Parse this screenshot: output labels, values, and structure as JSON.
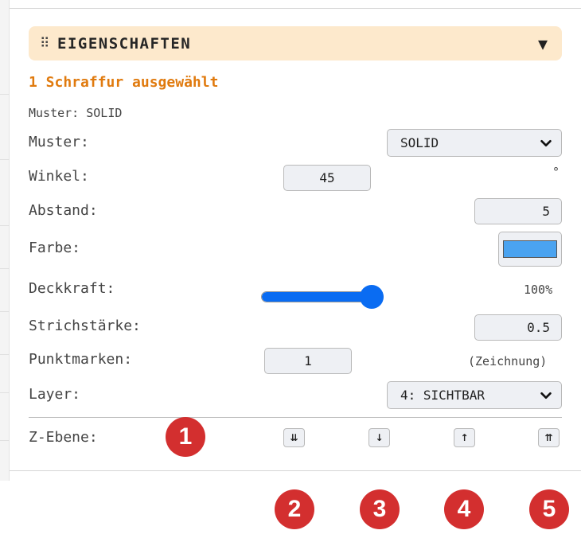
{
  "panel": {
    "title": "EIGENSCHAFTEN",
    "grip_icon": "drag-grip-icon",
    "toggle_icon": "collapse-triangle-icon",
    "toggle_glyph": "▼"
  },
  "selection": {
    "title": "1 Schraffur ausgewählt",
    "subtitle": "Muster: SOLID"
  },
  "fields": {
    "muster": {
      "label": "Muster:",
      "value": "SOLID"
    },
    "winkel": {
      "label": "Winkel:",
      "value": "45",
      "unit": "°"
    },
    "abstand": {
      "label": "Abstand:",
      "value": "5"
    },
    "farbe": {
      "label": "Farbe:",
      "color": "#4aa3f0"
    },
    "deckkraft": {
      "label": "Deckkraft:",
      "value_text": "100%",
      "level": 0.9
    },
    "strichstaerke": {
      "label": "Strichstärke:",
      "value": "0.5"
    },
    "punktmarken": {
      "label": "Punktmarken:",
      "value": "1",
      "unit": "(Zeichnung)"
    },
    "layer": {
      "label": "Layer:",
      "value": "4: SICHTBAR"
    },
    "z_ebene": {
      "label": "Z-Ebene:",
      "buttons": [
        {
          "name": "z-to-bottom-button",
          "glyph": "⇊"
        },
        {
          "name": "z-down-button",
          "glyph": "↓"
        },
        {
          "name": "z-up-button",
          "glyph": "↑"
        },
        {
          "name": "z-to-top-button",
          "glyph": "⇈"
        }
      ]
    }
  },
  "badges": [
    "1",
    "2",
    "3",
    "4",
    "5"
  ],
  "colors": {
    "accent": "#e07a0e",
    "header_bg": "#fde9cc",
    "slider": "#0a6cf2",
    "badge": "#d32f2f"
  }
}
